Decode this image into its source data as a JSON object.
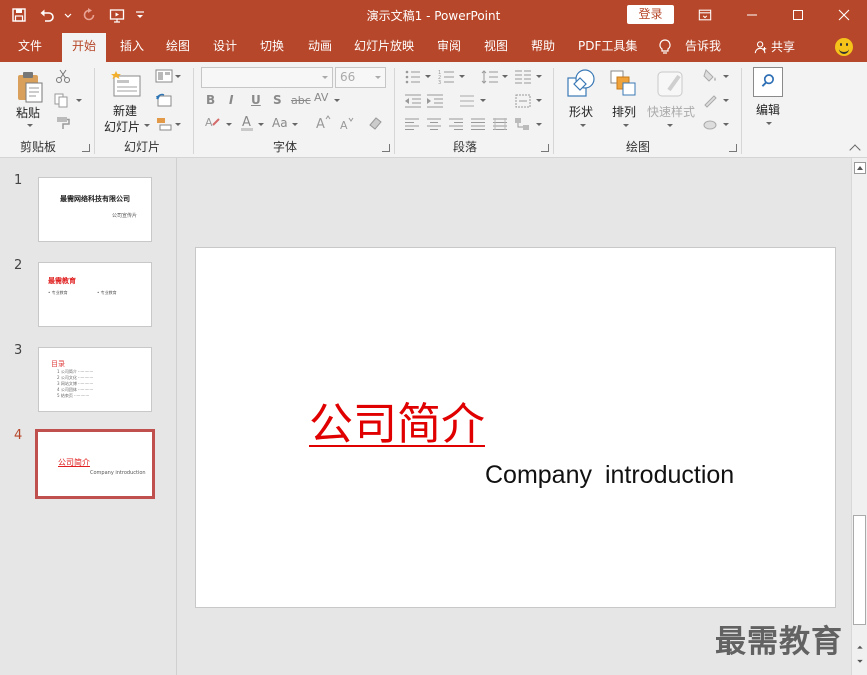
{
  "titlebar": {
    "doc_title": "演示文稿1  -  PowerPoint",
    "login_label": "登录",
    "quick_access": [
      "save-icon",
      "undo-icon",
      "redo-icon",
      "start-from-beginning-icon",
      "customize-qat-icon"
    ]
  },
  "tabs": [
    "文件",
    "开始",
    "插入",
    "绘图",
    "设计",
    "切换",
    "动画",
    "幻灯片放映",
    "审阅",
    "视图",
    "帮助",
    "PDF工具集"
  ],
  "tell_me": "告诉我",
  "share_label": "共享",
  "ribbon": {
    "clipboard": {
      "paste_label": "粘贴",
      "group_label": "剪贴板"
    },
    "slides": {
      "new_slide_label_1": "新建",
      "new_slide_label_2": "幻灯片",
      "group_label": "幻灯片"
    },
    "font": {
      "font_name": "",
      "font_size": "66",
      "group_label": "字体",
      "bold": "B",
      "italic": "I",
      "underline": "U",
      "shadow": "S",
      "strike": "abc",
      "spacing": "AV",
      "case": "Aa"
    },
    "paragraph": {
      "group_label": "段落"
    },
    "drawing": {
      "shapes_label": "形状",
      "arrange_label": "排列",
      "quick_styles_label": "快速样式",
      "group_label": "绘图"
    },
    "editing": {
      "edit_label": "编辑"
    }
  },
  "thumbnails": [
    {
      "num": "1",
      "title": "最需网络科技有限公司",
      "subtitle": "公司宣传片"
    },
    {
      "num": "2",
      "title": "最需教育",
      "bullet_1": "• 专业教育",
      "bullet_2": "• 专业教育"
    },
    {
      "num": "3",
      "title": "目录",
      "lines": [
        "1 公司简介 ············",
        "2 公司文化 ············",
        "3 网站文博 ············",
        "4 公司团体 ············",
        "5 结束页 ············"
      ]
    },
    {
      "num": "4",
      "title": "公司简介",
      "subtitle": "Company  introduction"
    }
  ],
  "slide": {
    "title": "公司简介",
    "subtitle": "Company  introduction"
  },
  "watermark": "最需教育",
  "colors": {
    "accent": "#b7472a",
    "slide_title": "#e00000"
  }
}
